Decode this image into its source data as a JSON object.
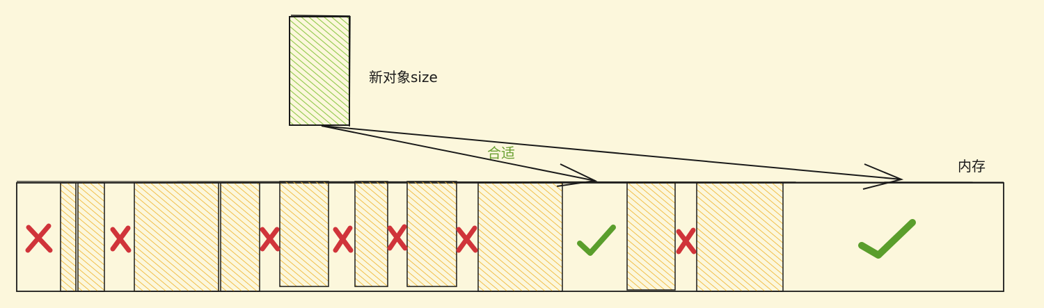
{
  "title": "",
  "new_object": {
    "label": "新对象size",
    "fill_color": "#8fc848",
    "stroke_color": "#1a1a1a"
  },
  "fit_label": {
    "text": "合适",
    "color": "#6aa032"
  },
  "memory_label": "内存",
  "colors": {
    "background": "#fcf7dc",
    "used_block": "#f0b93a",
    "cross": "#d0343a",
    "check": "#5a9e2c",
    "outline": "#1a1a1a"
  },
  "memory_layout": [
    {
      "kind": "free",
      "status": "no_fit"
    },
    {
      "kind": "used"
    },
    {
      "kind": "used"
    },
    {
      "kind": "free",
      "status": "no_fit"
    },
    {
      "kind": "used"
    },
    {
      "kind": "used"
    },
    {
      "kind": "free",
      "status": "no_fit"
    },
    {
      "kind": "used"
    },
    {
      "kind": "free",
      "status": "no_fit"
    },
    {
      "kind": "used"
    },
    {
      "kind": "free",
      "status": "no_fit"
    },
    {
      "kind": "used"
    },
    {
      "kind": "free",
      "status": "no_fit"
    },
    {
      "kind": "used"
    },
    {
      "kind": "free",
      "status": "fit"
    },
    {
      "kind": "used"
    },
    {
      "kind": "free",
      "status": "no_fit"
    },
    {
      "kind": "used"
    },
    {
      "kind": "free",
      "status": "fit"
    }
  ]
}
